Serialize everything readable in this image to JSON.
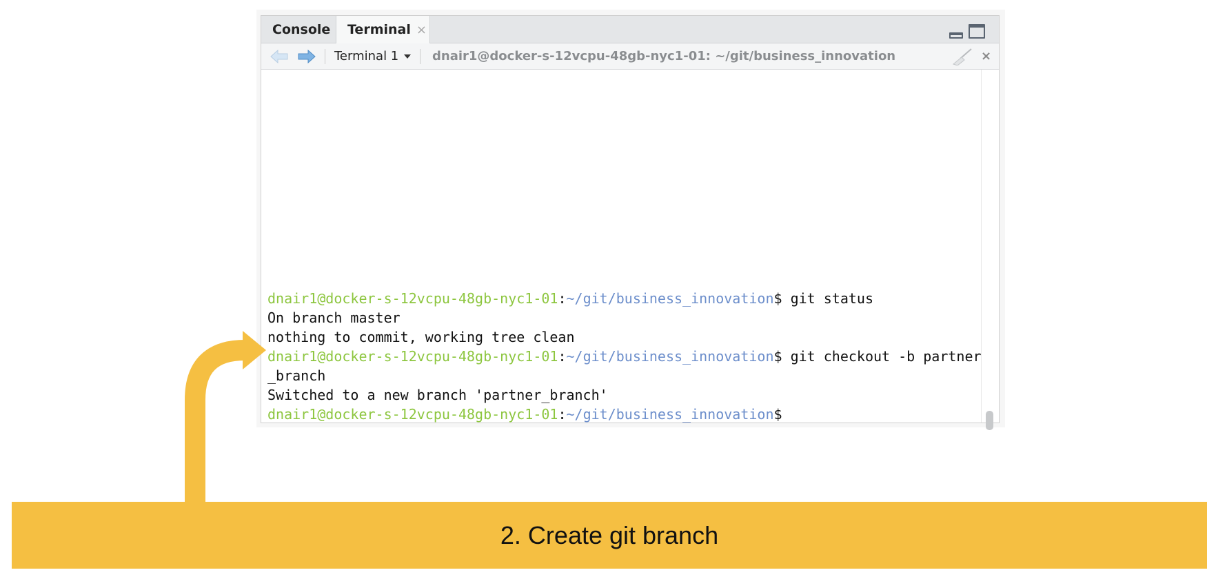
{
  "tabs": [
    {
      "label": "Console"
    },
    {
      "label": "Terminal",
      "close": "×"
    }
  ],
  "toolbar": {
    "terminal_select": "Terminal 1",
    "title": "dnair1@docker-s-12vcpu-48gb-nyc1-01: ~/git/business_innovation",
    "close": "×"
  },
  "terminal": {
    "host": "dnair1@docker-s-12vcpu-48gb-nyc1-01",
    "colon": ":",
    "path": "~/git/business_innovation",
    "prompt_end": "$",
    "cmd1": " git status",
    "out1": "On branch master",
    "out2": "nothing to commit, working tree clean",
    "cmd2": " git checkout -b partner",
    "cmd2_wrap": "_branch",
    "out3": "Switched to a new branch 'partner_branch'"
  },
  "banner": {
    "text": "2. Create git branch"
  },
  "colors": {
    "accent": "#f5bf42",
    "host_green": "#8dc63f",
    "path_blue": "#6c8ecb"
  }
}
